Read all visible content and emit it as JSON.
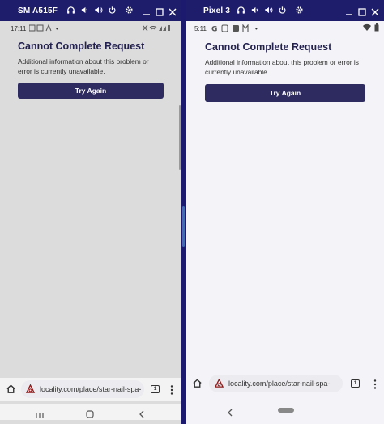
{
  "left_device": {
    "window_title": "SM A515F",
    "status": {
      "time": "17:11",
      "dot": "•"
    },
    "page": {
      "heading": "Cannot Complete Request",
      "description": "Additional information about this problem or error is currently unavailable.",
      "button_label": "Try Again"
    },
    "browser": {
      "url": "locality.com/place/star-nail-spa-",
      "tab_count": "1"
    }
  },
  "right_device": {
    "window_title": "Pixel 3",
    "status": {
      "time": "5:11",
      "dot": "•"
    },
    "page": {
      "heading": "Cannot Complete Request",
      "description": "Additional information about this problem or error is currently unavailable.",
      "button_label": "Try Again"
    },
    "browser": {
      "url": "locality.com/place/star-nail-spa-",
      "tab_count": "1"
    }
  },
  "colors": {
    "titlebar": "#1e1d6b",
    "button": "#2d2b5f",
    "heading": "#23214f",
    "left_bg": "#dcdcdc",
    "right_bg": "#f4f4f8"
  },
  "icons": [
    "headphones-icon",
    "volume-down-icon",
    "volume-up-icon",
    "power-icon",
    "gear-icon",
    "minimize-icon",
    "maximize-icon",
    "close-icon",
    "home-icon",
    "tabs-icon",
    "menu-icon",
    "back-icon",
    "wifi-icon",
    "battery-icon"
  ]
}
